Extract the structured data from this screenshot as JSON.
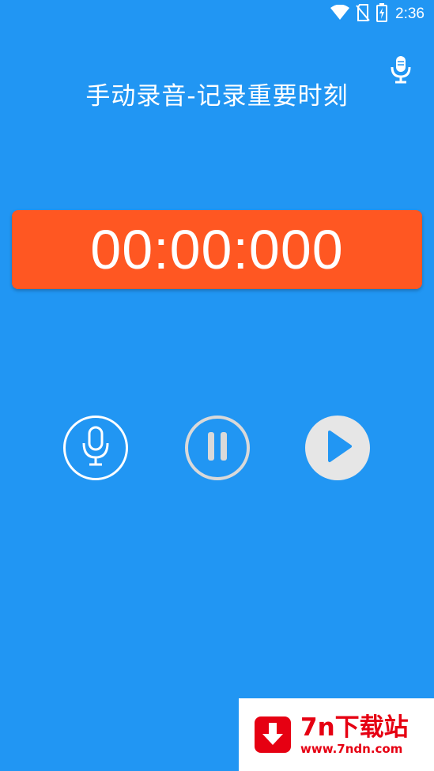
{
  "status_bar": {
    "time": "2:36",
    "icons": [
      "wifi-icon",
      "no-sim-icon",
      "battery-charging-icon"
    ]
  },
  "header": {
    "title": "手动录音-记录重要时刻",
    "mic_icon": "microphone-icon"
  },
  "timer": {
    "display": "00:00:000"
  },
  "controls": [
    {
      "name": "record",
      "icon": "microphone-icon"
    },
    {
      "name": "pause",
      "icon": "pause-icon"
    },
    {
      "name": "play",
      "icon": "play-icon"
    }
  ],
  "watermark": {
    "name": "7n下载站",
    "url": "www.7ndn.com"
  },
  "colors": {
    "background": "#2196F3",
    "timer_box": "#FF5722",
    "play_triangle": "#2196F3",
    "watermark_red": "#E60012"
  }
}
